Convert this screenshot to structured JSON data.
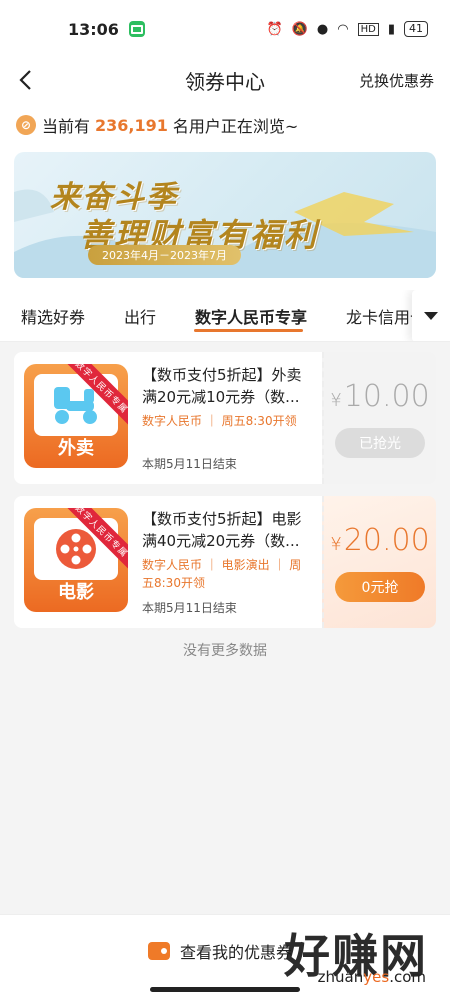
{
  "status": {
    "time": "13:06",
    "battery": "41"
  },
  "header": {
    "title": "领券中心",
    "exchange": "兑换优惠券"
  },
  "viewers": {
    "prefix": "当前有",
    "count": "236,191",
    "suffix": "名用户正在浏览~"
  },
  "banner": {
    "line1": "来奋斗季",
    "line2": "善理财富有福利",
    "date": "2023年4月－2023年7月"
  },
  "tabs": [
    "精选好券",
    "出行",
    "数字人民币专享",
    "龙卡信用卡专"
  ],
  "coupons": [
    {
      "ribbon": "数字人民币专属",
      "thumb_label": "外卖",
      "name": "【数币支付5折起】外卖满20元减10元券（数...",
      "tags": "数字人民币 ｜ 周五8:30开领",
      "end": "本期5月11日结束",
      "currency": "¥",
      "price": "10.00",
      "button": "已抢光"
    },
    {
      "ribbon": "数字人民币专属",
      "thumb_label": "电影",
      "name": "【数币支付5折起】电影满40元减20元券（数...",
      "tags": "数字人民币 ｜ 电影演出 ｜ 周五8:30开领",
      "end": "本期5月11日结束",
      "currency": "¥",
      "price": "20.00",
      "button": "0元抢"
    }
  ],
  "no_more": "没有更多数据",
  "bottom": {
    "my_coupons": "查看我的优惠券"
  },
  "watermark": {
    "text": "好赚网",
    "url_a": "zhuan",
    "url_b": "yes",
    "url_c": ".com"
  }
}
